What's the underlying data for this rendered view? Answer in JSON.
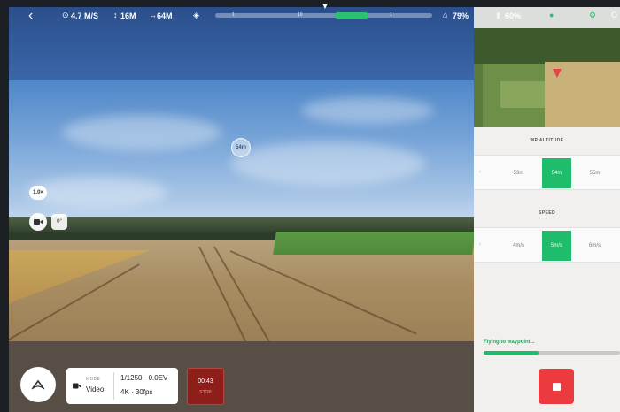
{
  "status_bar": {
    "speed": "4.7 M/S",
    "height": "16M",
    "distance": "64M",
    "progress_ticks": [
      "1",
      "10",
      "1"
    ],
    "signal_percent": "79%",
    "battery_percent": "60%"
  },
  "camera_view": {
    "waypoint_marker": "54m",
    "zoom_label": "1.0×",
    "gimbal_label": "0°"
  },
  "capture": {
    "mode_caption": "MODE",
    "mode_value": "Video",
    "exposure": "1/1250 · 0.0EV",
    "resolution": "4K · 30fps",
    "record_time": "00:43",
    "record_label": "STOP"
  },
  "right_panel": {
    "altitude_section": {
      "title": "WP ALTITUDE",
      "options": [
        "53m",
        "54m",
        "55m"
      ],
      "selected_index": 1
    },
    "speed_section": {
      "title": "SPEED",
      "options": [
        "4m/s",
        "5m/s",
        "6m/s"
      ],
      "selected_index": 1
    },
    "flight_status": "Flying to waypoint...",
    "flight_progress": 0.4
  },
  "colors": {
    "accent_green": "#1fbc6c",
    "stop_red": "#ec3b3f",
    "record_red": "#8e1e1a"
  }
}
